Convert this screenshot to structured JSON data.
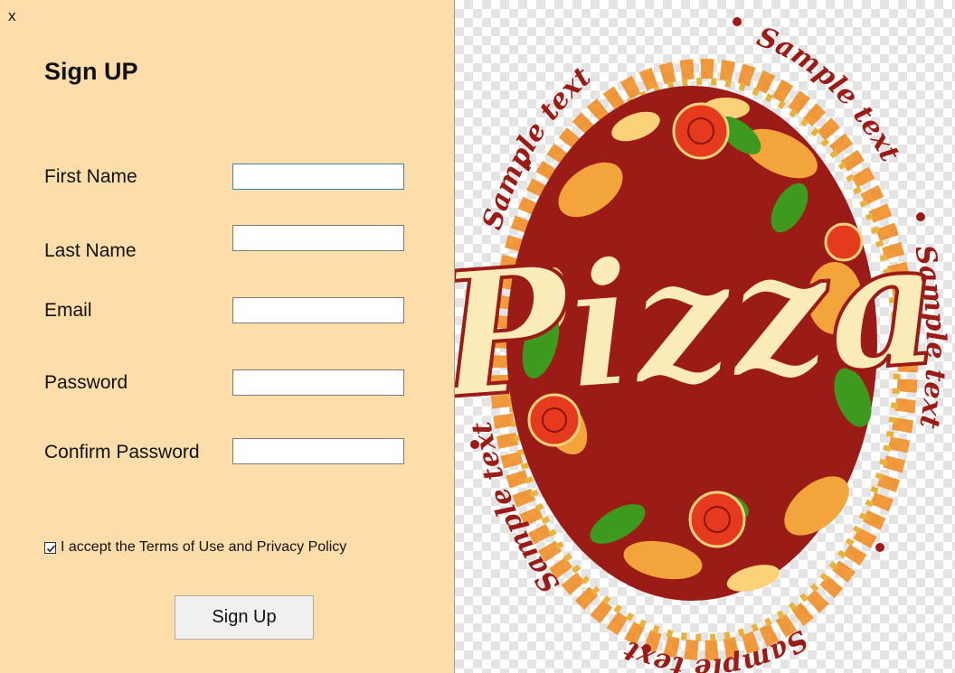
{
  "window": {
    "close_label": "x"
  },
  "form": {
    "title": "Sign UP",
    "fields": [
      {
        "label": "First Name",
        "value": ""
      },
      {
        "label": "Last Name",
        "value": ""
      },
      {
        "label": "Email",
        "value": ""
      },
      {
        "label": "Password",
        "value": ""
      },
      {
        "label": "Confirm Password",
        "value": ""
      }
    ],
    "terms_label": "I accept the Terms of Use and Privacy Policy",
    "terms_checked": true,
    "submit_label": "Sign Up"
  },
  "image": {
    "logo_text": "Pizza",
    "ring_text": "Sample text",
    "colors": {
      "panel_bg": "#FDDEAA",
      "logo_red": "#9B1B17",
      "logo_cream": "#FBEBB8",
      "leaf_green": "#3E9A1E",
      "tomato": "#E53A1E",
      "orange": "#F08A1C"
    }
  }
}
